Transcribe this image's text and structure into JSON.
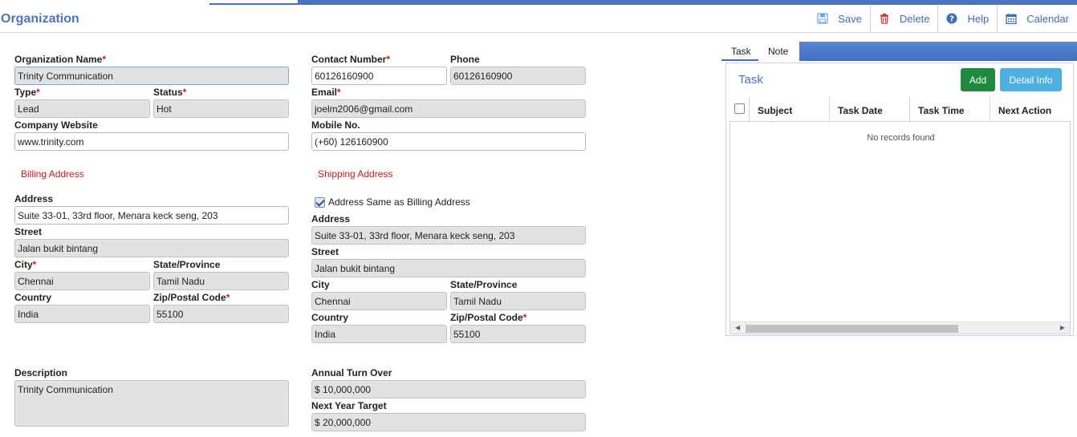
{
  "header": {
    "title": "Organization",
    "toolbar": {
      "save": "Save",
      "delete": "Delete",
      "help": "Help",
      "calendar": "Calendar"
    }
  },
  "form": {
    "org_name": {
      "label": "Organization Name",
      "value": "Trinity Communication"
    },
    "type": {
      "label": "Type",
      "value": "Lead"
    },
    "status": {
      "label": "Status",
      "value": "Hot"
    },
    "website": {
      "label": "Company Website",
      "value": "www.trinity.com"
    },
    "contact_number": {
      "label": "Contact Number",
      "value": "60126160900"
    },
    "phone": {
      "label": "Phone",
      "value": "60126160900"
    },
    "email": {
      "label": "Email",
      "value": "joelm2006@gmail.com"
    },
    "mobile": {
      "label": "Mobile No.",
      "value": "(+60) 126160900"
    },
    "billing": {
      "section": "Billing Address",
      "address": {
        "label": "Address",
        "value": "Suite 33-01, 33rd floor, Menara keck seng, 203"
      },
      "street": {
        "label": "Street",
        "value": "Jalan bukit bintang"
      },
      "city": {
        "label": "City",
        "value": "Chennai"
      },
      "state": {
        "label": "State/Province",
        "value": "Tamil Nadu"
      },
      "country": {
        "label": "Country",
        "value": "India"
      },
      "zip": {
        "label": "Zip/Postal Code",
        "value": "55100"
      }
    },
    "shipping": {
      "section": "Shipping Address",
      "same_as_billing": "Address Same as Billing Address",
      "address": {
        "label": "Address",
        "value": "Suite 33-01, 33rd floor, Menara keck seng, 203"
      },
      "street": {
        "label": "Street",
        "value": "Jalan bukit bintang"
      },
      "city": {
        "label": "City",
        "value": "Chennai"
      },
      "state": {
        "label": "State/Province",
        "value": "Tamil Nadu"
      },
      "country": {
        "label": "Country",
        "value": "India"
      },
      "zip": {
        "label": "Zip/Postal Code",
        "value": "55100"
      }
    },
    "description": {
      "label": "Description",
      "value": "Trinity Communication"
    },
    "annual_turnover": {
      "label": "Annual Turn Over",
      "value": "$ 10,000,000"
    },
    "next_year_target": {
      "label": "Next Year Target",
      "value": "$ 20,000,000"
    }
  },
  "right_panel": {
    "tabs": [
      "Task",
      "Note"
    ],
    "title": "Task",
    "add_label": "Add",
    "detail_label": "Detail Info",
    "columns": [
      "Subject",
      "Task Date",
      "Task Time",
      "Next Action"
    ],
    "empty_text": "No records found"
  },
  "colors": {
    "accent": "#4a74c3",
    "required": "#d01818",
    "add_button": "#1f8a3e",
    "detail_button": "#4eb0e0"
  }
}
